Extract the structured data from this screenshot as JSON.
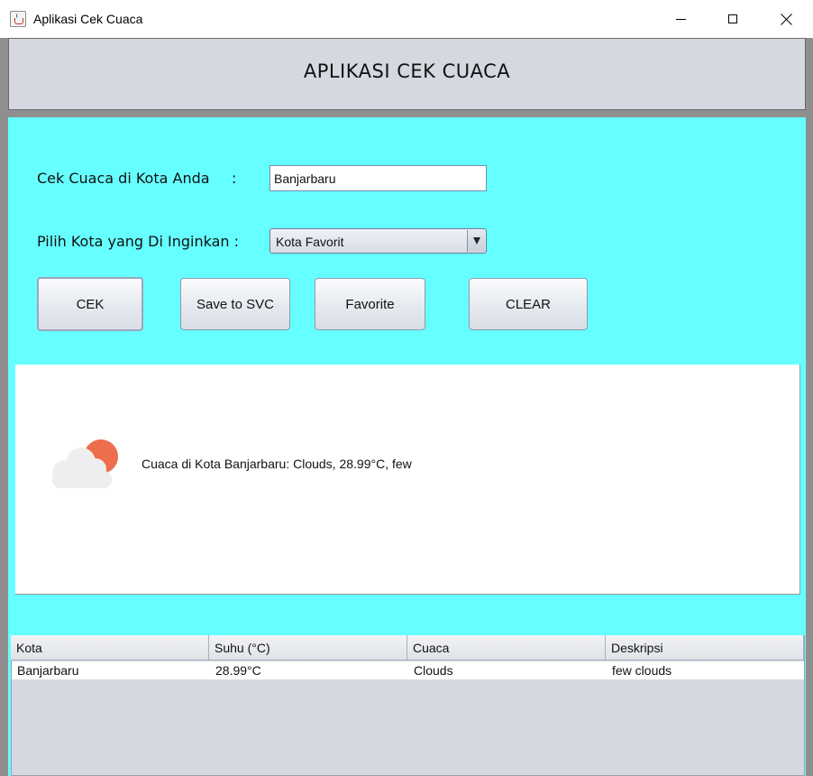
{
  "window": {
    "title": "Aplikasi Cek Cuaca"
  },
  "header": {
    "title": "APLIKASI CEK CUACA"
  },
  "form": {
    "city_label": "Cek Cuaca di Kota Anda",
    "city_colon": ":",
    "city_value": "Banjarbaru",
    "pick_label": "Pilih Kota yang Di Inginkan :",
    "pick_selected": "Kota Favorit"
  },
  "buttons": {
    "cek": "CEK",
    "save": "Save to SVC",
    "favorite": "Favorite",
    "clear": "CLEAR"
  },
  "result": {
    "icon": "partly-cloudy-icon",
    "text": "Cuaca di Kota Banjarbaru: Clouds, 28.99°C, few"
  },
  "table": {
    "columns": [
      "Kota",
      "Suhu (°C)",
      "Cuaca",
      "Deskripsi"
    ],
    "rows": [
      [
        "Banjarbaru",
        "28.99°C",
        "Clouds",
        "few clouds"
      ]
    ]
  },
  "colors": {
    "panel_bg": "#66ffff",
    "header_bg": "#d5d8e0",
    "sun": "#ec6e4c",
    "cloud": "#eeeeee"
  }
}
